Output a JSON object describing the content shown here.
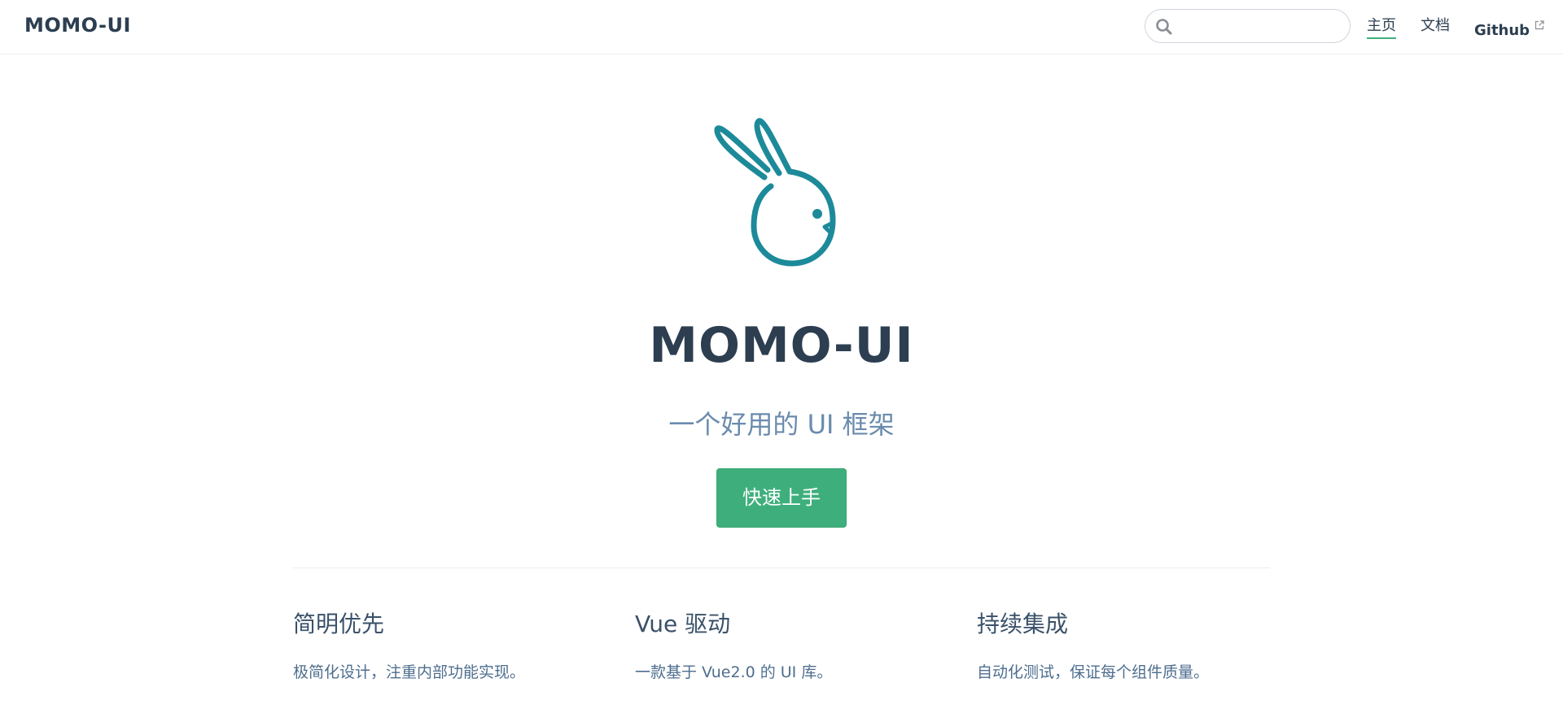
{
  "navbar": {
    "site_name": "MOMO-UI",
    "search": {
      "value": "",
      "placeholder": ""
    },
    "links": [
      {
        "label": "主页",
        "active": true
      },
      {
        "label": "文档",
        "active": false
      },
      {
        "label": "Github",
        "external": true
      }
    ]
  },
  "hero": {
    "logo_icon": "rabbit-logo-icon",
    "title": "MOMO-UI",
    "description": "一个好用的 UI 框架",
    "action_label": "快速上手"
  },
  "features": [
    {
      "title": "简明优先",
      "details": "极简化设计，注重内部功能实现。"
    },
    {
      "title": "Vue 驱动",
      "details": "一款基于 Vue2.0 的 UI 库。"
    },
    {
      "title": "持续集成",
      "details": "自动化测试，保证每个组件质量。"
    }
  ],
  "colors": {
    "accent": "#3eaf7c",
    "logo": "#1d8a9a",
    "text": "#2c3e50",
    "description": "#6a8bad"
  }
}
